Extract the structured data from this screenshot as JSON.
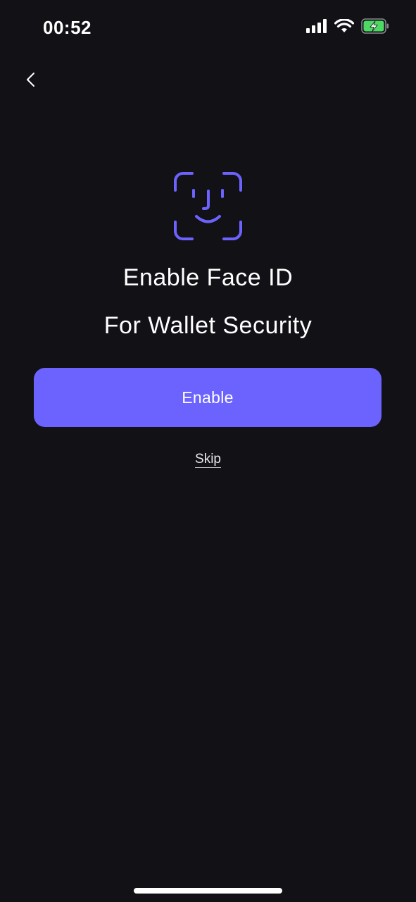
{
  "status_bar": {
    "time": "00:52",
    "icons": [
      "cellular-signal-icon",
      "wifi-icon",
      "battery-charging-icon"
    ]
  },
  "nav": {
    "back_icon": "chevron-left-icon"
  },
  "hero": {
    "icon": "face-id-icon",
    "title_line_1": "Enable Face ID",
    "title_line_2": "For Wallet Security"
  },
  "actions": {
    "enable_label": "Enable",
    "skip_label": "Skip"
  },
  "colors": {
    "background": "#121116",
    "accent": "#6c63ff",
    "battery": "#4cd964"
  }
}
